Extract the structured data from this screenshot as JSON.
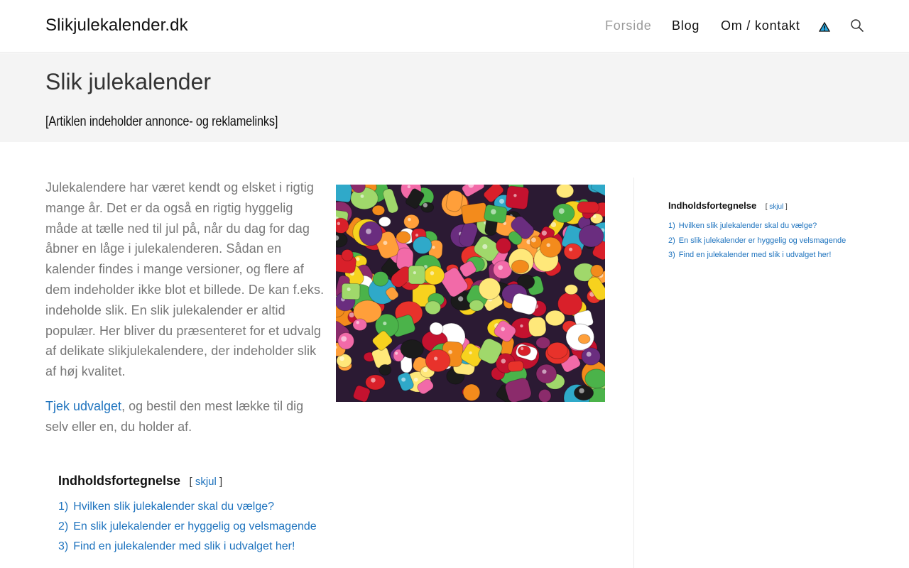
{
  "header": {
    "site_title": "Slikjulekalender.dk",
    "nav": {
      "home": "Forside",
      "blog": "Blog",
      "contact": "Om / kontakt"
    },
    "icons": [
      "warning-icon",
      "search-icon"
    ]
  },
  "page": {
    "title": "Slik julekalender",
    "disclaimer": "[Artiklen indeholder annonce- og reklamelinks]"
  },
  "content": {
    "intro": "Julekalendere har været kendt og elsket i rigtig mange år. Det er da også en rigtig hyggelig måde at tælle ned til jul på, når du dag for dag åbner en låge i julekalenderen. Sådan en kalender findes i mange versioner, og flere af dem indeholder ikke blot et billede. De kan f.eks. indeholde slik. En slik julekalender er altid populær. Her bliver du præsenteret for et udvalg af delikate slikjulekalendere, der indeholder slik af høj kvalitet.",
    "cta_link": "Tjek udvalget",
    "cta_rest": ", og bestil den mest lække til dig selv eller en, du holder af."
  },
  "toc": {
    "title": "Indholdsfortegnelse",
    "toggle_open": "[",
    "toggle_label": "skjul",
    "toggle_close": "]",
    "items": [
      {
        "num": "1)",
        "label": "Hvilken slik julekalender skal du vælge?"
      },
      {
        "num": "2)",
        "label": "En slik julekalender er hyggelig og velsmagende"
      },
      {
        "num": "3)",
        "label": "Find en julekalender med slik i udvalget her!"
      }
    ]
  },
  "colors": {
    "link": "#1e73be",
    "nav_active": "#999999",
    "title_band": "#f4f4f4",
    "body_text": "#777777"
  }
}
